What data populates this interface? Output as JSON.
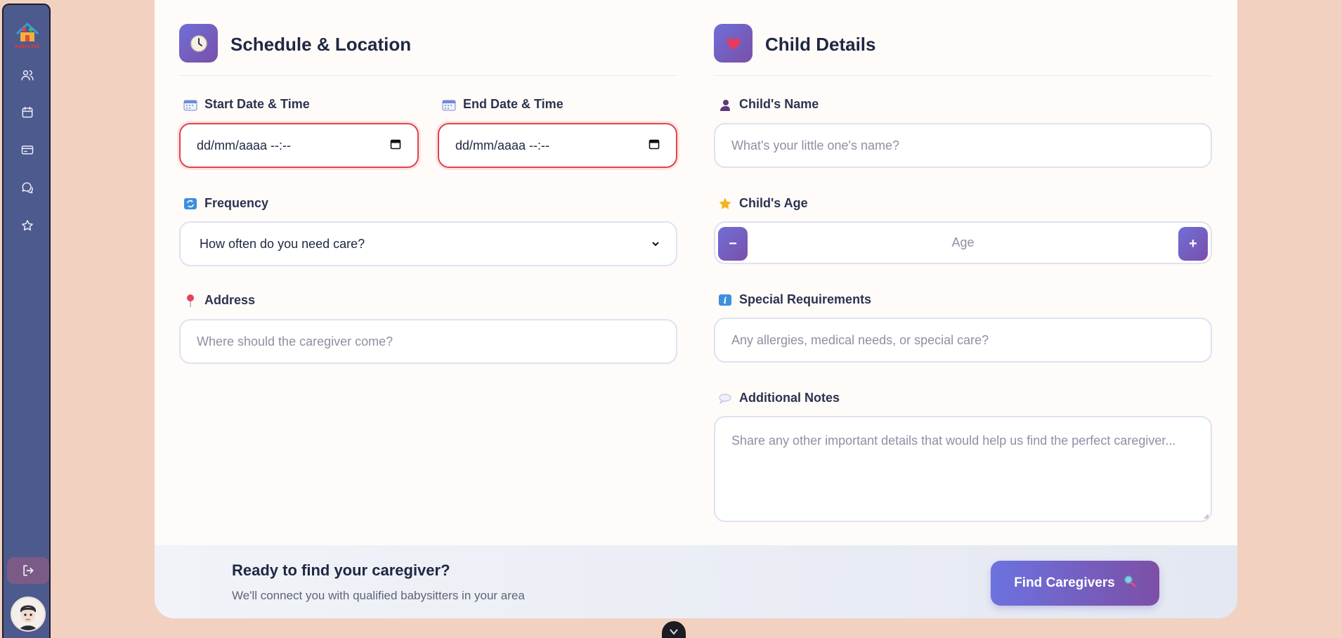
{
  "sidebar": {
    "logo_text": "BABYCARE",
    "nav_items": [
      {
        "icon": "users-icon",
        "label": "Caregivers"
      },
      {
        "icon": "calendar-icon",
        "label": "Bookings"
      },
      {
        "icon": "credit-card-icon",
        "label": "Payments"
      },
      {
        "icon": "messages-icon",
        "label": "Messages"
      },
      {
        "icon": "star-icon",
        "label": "Reviews"
      }
    ],
    "logout_icon": "logout-icon",
    "avatar": "user-avatar"
  },
  "schedule": {
    "title": "Schedule & Location",
    "icon": "clock-icon",
    "start_label": "Start Date & Time",
    "start_value": "dd/mm/aaaa --:--",
    "end_label": "End Date & Time",
    "end_value": "dd/mm/aaaa --:--",
    "frequency_label": "Frequency",
    "frequency_value": "How often do you need care?",
    "address_label": "Address",
    "address_placeholder": "Where should the caregiver come?"
  },
  "child": {
    "title": "Child Details",
    "icon": "heart-icon",
    "name_label": "Child's Name",
    "name_placeholder": "What's your little one's name?",
    "age_label": "Child's Age",
    "age_placeholder": "Age",
    "minus": "−",
    "plus": "+",
    "special_label": "Special Requirements",
    "special_placeholder": "Any allergies, medical needs, or special care?",
    "notes_label": "Additional Notes",
    "notes_placeholder": "Share any other important details that would help us find the perfect caregiver..."
  },
  "footer": {
    "title": "Ready to find your caregiver?",
    "subtitle": "We'll connect you with qualified babysitters in your area",
    "button": "Find Caregivers"
  },
  "colors": {
    "background": "#f3d1c1",
    "sidebar": "#4d5a8e",
    "accent": "#6f6fd8",
    "error": "#e0454c"
  }
}
